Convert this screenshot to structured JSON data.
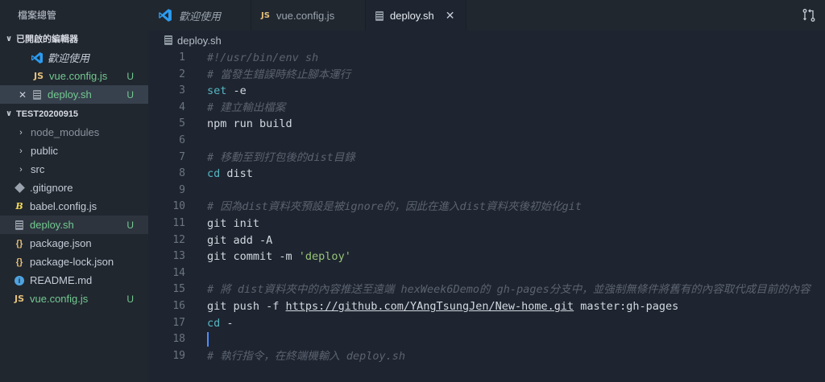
{
  "sidebar": {
    "title": "檔案總管",
    "open_editors": {
      "header": "已開啟的編輯器",
      "items": [
        {
          "label": "歡迎使用",
          "badge": "",
          "icon": "vscode-logo-icon"
        },
        {
          "label": "vue.config.js",
          "badge": "U",
          "icon": "js-file-icon"
        },
        {
          "label": "deploy.sh",
          "badge": "U",
          "icon": "shell-file-icon"
        }
      ]
    },
    "project": {
      "header": "TEST20200915",
      "items": [
        {
          "label": "node_modules",
          "badge": "",
          "type": "folder"
        },
        {
          "label": "public",
          "badge": "",
          "type": "folder"
        },
        {
          "label": "src",
          "badge": "",
          "type": "folder"
        },
        {
          "label": ".gitignore",
          "badge": "",
          "type": "file"
        },
        {
          "label": "babel.config.js",
          "badge": "",
          "type": "file"
        },
        {
          "label": "deploy.sh",
          "badge": "U",
          "type": "file"
        },
        {
          "label": "package.json",
          "badge": "",
          "type": "file"
        },
        {
          "label": "package-lock.json",
          "badge": "",
          "type": "file"
        },
        {
          "label": "README.md",
          "badge": "",
          "type": "file"
        },
        {
          "label": "vue.config.js",
          "badge": "U",
          "type": "file"
        }
      ]
    }
  },
  "tabs": [
    {
      "label": "歡迎使用"
    },
    {
      "label": "vue.config.js"
    },
    {
      "label": "deploy.sh",
      "close": "✕"
    }
  ],
  "breadcrumb": "deploy.sh",
  "code": {
    "line_numbers": [
      "1",
      "2",
      "3",
      "4",
      "5",
      "6",
      "7",
      "8",
      "9",
      "10",
      "11",
      "12",
      "13",
      "14",
      "15",
      "16",
      "17",
      "18",
      "19"
    ],
    "l1": "#!/usr/bin/env sh",
    "l2": "# 當發生錯誤時終止腳本運行",
    "l3_kw": "set",
    "l3_rest": " -e",
    "l4": "# 建立輸出檔案",
    "l5": "npm run build",
    "l7": "# 移動至到打包後的dist目錄",
    "l8_kw": "cd",
    "l8_rest": " dist",
    "l10": "# 因為dist資料夾預設是被ignore的，因此在進入dist資料夾後初始化git",
    "l11": "git init",
    "l12": "git add -A",
    "l13_a": "git commit -m ",
    "l13_str": "'deploy'",
    "l15": "# 將 dist資料夾中的內容推送至遠端 hexWeek6Demo的 gh-pages分支中，並強制無條件將舊有的內容取代成目前的內容",
    "l16_a": "git push -f ",
    "l16_url": "https://github.com/YAngTsungJen/New-home.git",
    "l16_b": " master:gh-pages",
    "l17_kw": "cd",
    "l17_rest": " -",
    "l19": "# 執行指令，在終端機輸入 deploy.sh"
  }
}
